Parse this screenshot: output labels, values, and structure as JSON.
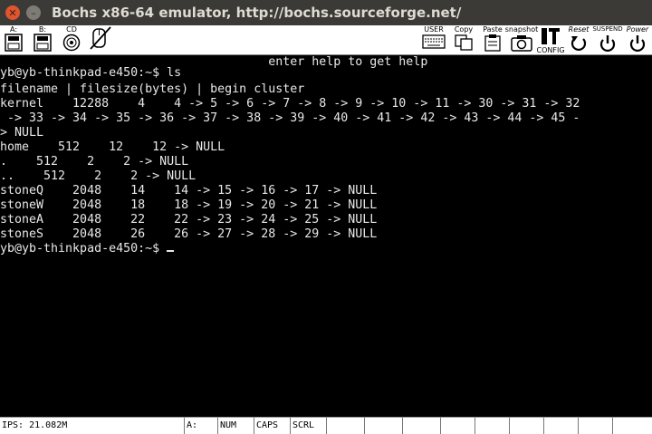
{
  "window": {
    "title": "Bochs x86-64 emulator, http://bochs.sourceforge.net/",
    "close_glyph": "✕",
    "minimize_glyph": "–"
  },
  "toolbar": {
    "floppy_a": {
      "label": "A:",
      "icon": "floppy-drive-icon"
    },
    "floppy_b": {
      "label": "B:",
      "icon": "floppy-drive-icon"
    },
    "cdrom": {
      "label": "CD",
      "icon": "cdrom-icon"
    },
    "mouse": {
      "label": "",
      "icon": "mouse-icon"
    },
    "user": {
      "label": "USER",
      "icon": "keyboard-icon"
    },
    "copy": {
      "label": "Copy",
      "icon": "copy-icon"
    },
    "paste": {
      "label": "Paste",
      "icon": "paste-icon"
    },
    "snapshot": {
      "label": "snapshot",
      "icon": "camera-icon"
    },
    "config": {
      "label": "CONFIG",
      "icon": "config-icon"
    },
    "reset": {
      "label": "Reset",
      "icon": "reset-icon"
    },
    "suspend": {
      "label": "SUSPEND",
      "icon": "suspend-icon"
    },
    "power": {
      "label": "Power",
      "icon": "power-icon"
    }
  },
  "screen": {
    "lines": [
      "                                     enter help to get help",
      "yb@yb-thinkpad-e450:~$ ls",
      "filename | filesize(bytes) | begin cluster",
      "kernel    12288    4    4 -> 5 -> 6 -> 7 -> 8 -> 9 -> 10 -> 11 -> 30 -> 31 -> 32",
      " -> 33 -> 34 -> 35 -> 36 -> 37 -> 38 -> 39 -> 40 -> 41 -> 42 -> 43 -> 44 -> 45 -",
      "> NULL",
      "home    512    12    12 -> NULL",
      ".    512    2    2 -> NULL",
      "..    512    2    2 -> NULL",
      "stoneQ    2048    14    14 -> 15 -> 16 -> 17 -> NULL",
      "stoneW    2048    18    18 -> 19 -> 20 -> 21 -> NULL",
      "stoneA    2048    22    22 -> 23 -> 24 -> 25 -> NULL",
      "stoneS    2048    26    26 -> 27 -> 28 -> 29 -> NULL",
      "yb@yb-thinkpad-e450:~$ "
    ]
  },
  "statusbar": {
    "ips": "IPS: 21.082M",
    "drive": "A:",
    "num": "NUM",
    "caps": "CAPS",
    "scrl": "SCRL"
  }
}
